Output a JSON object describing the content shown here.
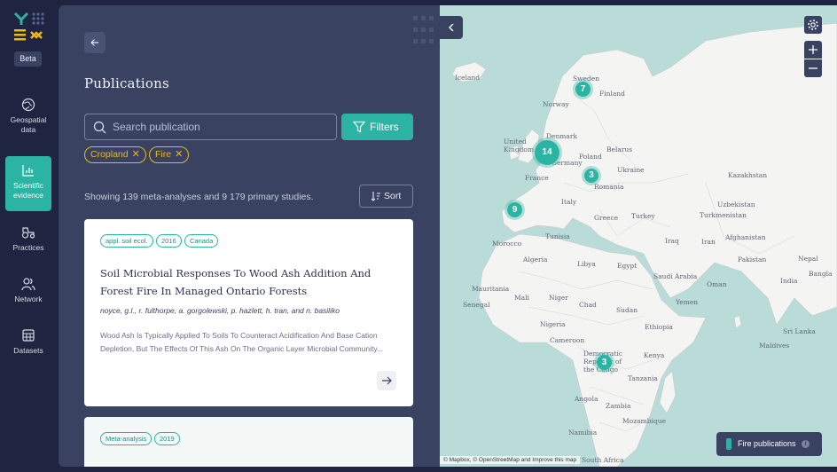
{
  "sidebar": {
    "beta_label": "Beta",
    "items": [
      {
        "label": "Geospatial data",
        "icon": "globe-icon",
        "active": false
      },
      {
        "label": "Scientific evidence",
        "icon": "bar-chart-icon",
        "active": true
      },
      {
        "label": "Practices",
        "icon": "tractor-icon",
        "active": false
      },
      {
        "label": "Network",
        "icon": "users-icon",
        "active": false
      },
      {
        "label": "Datasets",
        "icon": "table-icon",
        "active": false
      }
    ]
  },
  "panel": {
    "title": "Publications",
    "search_placeholder": "Search publication",
    "filters_label": "Filters",
    "active_filters": [
      "Cropland",
      "Fire"
    ],
    "showing_text": "Showing 139 meta-analyses and 9 179 primary studies.",
    "sort_label": "Sort",
    "publications": [
      {
        "tags": [
          "appl. soil ecol.",
          "2016",
          "Canada"
        ],
        "title": "Soil Microbial Responses To Wood Ash Addition And Forest Fire In Managed Ontario Forests",
        "authors": "noyce, g.l., r. fulthorpe, a. gorgolewski, p. hazlett, h. tran, and n. basiliko",
        "abstract": "Wood Ash Is Typically Applied To Soils To Counteract Acidification And Base Cation Depletion, But The Effects Of This Ash On The Organic Layer Microbial Community..."
      },
      {
        "tags": [
          "Meta-analysis",
          "2019"
        ]
      }
    ]
  },
  "map": {
    "clusters": [
      {
        "count": "7",
        "near": "Sweden"
      },
      {
        "count": "14",
        "near": "United Kingdom"
      },
      {
        "count": "3",
        "near": "Romania"
      },
      {
        "count": "9",
        "near": "Spain"
      },
      {
        "count": "3",
        "near": "Democratic Republic of the Congo"
      }
    ],
    "labels": [
      "Iceland",
      "Sweden",
      "Finland",
      "Norway",
      "Denmark",
      "United Kingdom",
      "Belarus",
      "Poland",
      "Germany",
      "Ukraine",
      "France",
      "Romania",
      "Kazakhstan",
      "Italy",
      "Uzbekistan",
      "Turkmenistan",
      "Greece",
      "Turkey",
      "Afghanistan",
      "Iraq",
      "Iran",
      "Morocco",
      "Tunisia",
      "Pakistan",
      "Nepal",
      "Algeria",
      "Libya",
      "Egypt",
      "Saudi Arabia",
      "India",
      "Bangla",
      "Oman",
      "Mauritania",
      "Mali",
      "Niger",
      "Chad",
      "Sudan",
      "Yemen",
      "Senegal",
      "Nigeria",
      "Ethiopia",
      "Cameroon",
      "Democratic Republic of the Congo",
      "Kenya",
      "Sri Lanka",
      "Maldives",
      "Tanzania",
      "Angola",
      "Zambia",
      "Mozambique",
      "Namibia",
      "South Africa"
    ],
    "attribution": "© Mapbox, © OpenStreetMap and Improve this map",
    "legend_label": "Fire publications",
    "colors": {
      "land": "#f4f4f2",
      "water": "#b9dcd8",
      "cluster": "#2bb3a3"
    }
  }
}
